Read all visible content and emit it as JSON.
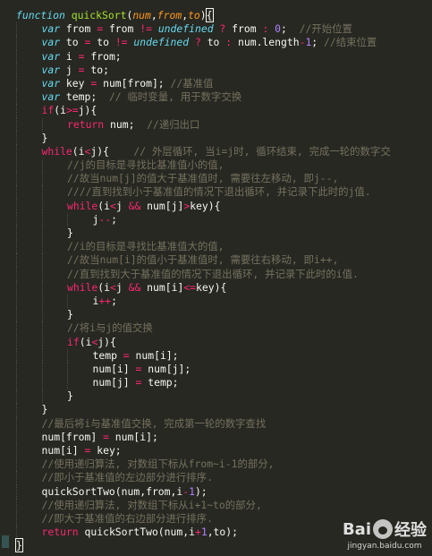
{
  "editor": {
    "colors": {
      "background": "#272822",
      "keyword": "#66d9ef",
      "function": "#a6e22e",
      "argument": "#fd971f",
      "operator": "#f92672",
      "number": "#ae81ff",
      "comment": "#75715e",
      "text": "#f8f8f2"
    },
    "lines": [
      {
        "indent": 0,
        "tokens": [
          [
            "kw",
            "function"
          ],
          [
            "plain",
            " "
          ],
          [
            "fn",
            "quickSort"
          ],
          [
            "plain",
            "("
          ],
          [
            "arg",
            "num"
          ],
          [
            "plain",
            ","
          ],
          [
            "arg",
            "from"
          ],
          [
            "plain",
            ","
          ],
          [
            "arg",
            "to"
          ],
          [
            "plain",
            ")"
          ],
          [
            "brace",
            "{"
          ]
        ]
      },
      {
        "indent": 1,
        "tokens": [
          [
            "kw",
            "var"
          ],
          [
            "plain",
            " from "
          ],
          [
            "pink",
            "="
          ],
          [
            "plain",
            " from "
          ],
          [
            "pink",
            "!="
          ],
          [
            "plain",
            " "
          ],
          [
            "kw",
            "undefined"
          ],
          [
            "plain",
            " "
          ],
          [
            "pink",
            "?"
          ],
          [
            "plain",
            " from "
          ],
          [
            "pink",
            ":"
          ],
          [
            "plain",
            " "
          ],
          [
            "num",
            "0"
          ],
          [
            "plain",
            ";  "
          ],
          [
            "cm",
            "//开始位置"
          ]
        ]
      },
      {
        "indent": 1,
        "tokens": [
          [
            "kw",
            "var"
          ],
          [
            "plain",
            " to "
          ],
          [
            "pink",
            "="
          ],
          [
            "plain",
            " to "
          ],
          [
            "pink",
            "!="
          ],
          [
            "plain",
            " "
          ],
          [
            "kw",
            "undefined"
          ],
          [
            "plain",
            " "
          ],
          [
            "pink",
            "?"
          ],
          [
            "plain",
            " to "
          ],
          [
            "pink",
            ":"
          ],
          [
            "plain",
            " num.length"
          ],
          [
            "pink",
            "-"
          ],
          [
            "num",
            "1"
          ],
          [
            "plain",
            "; "
          ],
          [
            "cm",
            "//结束位置"
          ]
        ]
      },
      {
        "indent": 1,
        "tokens": [
          [
            "kw",
            "var"
          ],
          [
            "plain",
            " i "
          ],
          [
            "pink",
            "="
          ],
          [
            "plain",
            " from;"
          ]
        ]
      },
      {
        "indent": 1,
        "tokens": [
          [
            "kw",
            "var"
          ],
          [
            "plain",
            " j "
          ],
          [
            "pink",
            "="
          ],
          [
            "plain",
            " to;"
          ]
        ]
      },
      {
        "indent": 1,
        "tokens": [
          [
            "kw",
            "var"
          ],
          [
            "plain",
            " key "
          ],
          [
            "pink",
            "="
          ],
          [
            "plain",
            " num[from]; "
          ],
          [
            "cm",
            "//基准值"
          ]
        ]
      },
      {
        "indent": 1,
        "tokens": [
          [
            "kw",
            "var"
          ],
          [
            "plain",
            " temp;  "
          ],
          [
            "cm",
            "// 临时变量, 用于数字交换"
          ]
        ]
      },
      {
        "indent": 1,
        "tokens": [
          [
            "pink",
            "if"
          ],
          [
            "plain",
            "(i"
          ],
          [
            "pink",
            ">="
          ],
          [
            "plain",
            "j){"
          ]
        ]
      },
      {
        "indent": 2,
        "tokens": [
          [
            "pink",
            "return"
          ],
          [
            "plain",
            " num;  "
          ],
          [
            "cm",
            "//递归出口"
          ]
        ]
      },
      {
        "indent": 1,
        "tokens": [
          [
            "plain",
            "}"
          ]
        ]
      },
      {
        "indent": 1,
        "tokens": [
          [
            "pink",
            "while"
          ],
          [
            "plain",
            "(i"
          ],
          [
            "pink",
            "<"
          ],
          [
            "plain",
            "j){    "
          ],
          [
            "cm",
            "// 外层循环, 当i=j时, 循环结束, 完成一轮的数字交"
          ]
        ]
      },
      {
        "indent": 2,
        "tokens": [
          [
            "cm",
            "//j的目标是寻找比基准值小的值,"
          ]
        ]
      },
      {
        "indent": 2,
        "tokens": [
          [
            "cm",
            "//故当num[j]的值大于基准值时, 需要往左移动, 即j--,"
          ]
        ]
      },
      {
        "indent": 2,
        "tokens": [
          [
            "cm",
            "////直到找到小于基准值的情况下退出循环, 并记录下此时的j值."
          ]
        ]
      },
      {
        "indent": 2,
        "tokens": [
          [
            "pink",
            "while"
          ],
          [
            "plain",
            "(i"
          ],
          [
            "pink",
            "<"
          ],
          [
            "plain",
            "j "
          ],
          [
            "pink",
            "&&"
          ],
          [
            "plain",
            " num[j]"
          ],
          [
            "pink",
            ">"
          ],
          [
            "plain",
            "key){"
          ]
        ]
      },
      {
        "indent": 3,
        "tokens": [
          [
            "plain",
            "j"
          ],
          [
            "pink",
            "--"
          ],
          [
            "plain",
            ";"
          ]
        ]
      },
      {
        "indent": 2,
        "tokens": [
          [
            "plain",
            "}"
          ]
        ]
      },
      {
        "indent": 2,
        "tokens": [
          [
            "cm",
            "//i的目标是寻找比基准值大的值,"
          ]
        ]
      },
      {
        "indent": 2,
        "tokens": [
          [
            "cm",
            "//故当num[i]的值小于基准值时, 需要往右移动, 即i++,"
          ]
        ]
      },
      {
        "indent": 2,
        "tokens": [
          [
            "cm",
            "//直到找到大于基准值的情况下退出循环, 并记录下此时的i值."
          ]
        ]
      },
      {
        "indent": 2,
        "tokens": [
          [
            "pink",
            "while"
          ],
          [
            "plain",
            "(i"
          ],
          [
            "pink",
            "<"
          ],
          [
            "plain",
            "j "
          ],
          [
            "pink",
            "&&"
          ],
          [
            "plain",
            " num[i]"
          ],
          [
            "pink",
            "<="
          ],
          [
            "plain",
            "key){"
          ]
        ]
      },
      {
        "indent": 3,
        "tokens": [
          [
            "plain",
            "i"
          ],
          [
            "pink",
            "++"
          ],
          [
            "plain",
            ";"
          ]
        ]
      },
      {
        "indent": 2,
        "tokens": [
          [
            "plain",
            "}"
          ]
        ]
      },
      {
        "indent": 2,
        "tokens": [
          [
            "cm",
            "//将i与j的值交换"
          ]
        ]
      },
      {
        "indent": 2,
        "tokens": [
          [
            "pink",
            "if"
          ],
          [
            "plain",
            "(i"
          ],
          [
            "pink",
            "<"
          ],
          [
            "plain",
            "j){"
          ]
        ]
      },
      {
        "indent": 3,
        "tokens": [
          [
            "plain",
            "temp "
          ],
          [
            "pink",
            "="
          ],
          [
            "plain",
            " num[i];"
          ]
        ]
      },
      {
        "indent": 3,
        "tokens": [
          [
            "plain",
            "num[i] "
          ],
          [
            "pink",
            "="
          ],
          [
            "plain",
            " num[j];"
          ]
        ]
      },
      {
        "indent": 3,
        "tokens": [
          [
            "plain",
            "num[j] "
          ],
          [
            "pink",
            "="
          ],
          [
            "plain",
            " temp;"
          ]
        ]
      },
      {
        "indent": 2,
        "tokens": [
          [
            "plain",
            "}"
          ]
        ]
      },
      {
        "indent": 1,
        "tokens": [
          [
            "plain",
            "}"
          ]
        ]
      },
      {
        "indent": 1,
        "tokens": [
          [
            "cm",
            "//最后将i与基准值交换, 完成第一轮的数字查找"
          ]
        ]
      },
      {
        "indent": 1,
        "tokens": [
          [
            "plain",
            "num[from] "
          ],
          [
            "pink",
            "="
          ],
          [
            "plain",
            " num[i];"
          ]
        ]
      },
      {
        "indent": 1,
        "tokens": [
          [
            "plain",
            "num[i] "
          ],
          [
            "pink",
            "="
          ],
          [
            "plain",
            " key;"
          ]
        ]
      },
      {
        "indent": 1,
        "tokens": [
          [
            "cm",
            "//使用递归算法, 对数组下标从from~i-1的部分,"
          ]
        ]
      },
      {
        "indent": 1,
        "tokens": [
          [
            "cm",
            "//即小于基准值的左边部分进行排序."
          ]
        ]
      },
      {
        "indent": 1,
        "tokens": [
          [
            "plain",
            "quickSortTwo(num,from,i"
          ],
          [
            "pink",
            "-"
          ],
          [
            "num",
            "1"
          ],
          [
            "plain",
            ");"
          ]
        ]
      },
      {
        "indent": 1,
        "tokens": [
          [
            "cm",
            "//使用递归算法, 对数组下标从i+1~to的部分,"
          ]
        ]
      },
      {
        "indent": 1,
        "tokens": [
          [
            "cm",
            "//即大于基准值的右边部分进行排序."
          ]
        ]
      },
      {
        "indent": 1,
        "tokens": [
          [
            "pink",
            "return"
          ],
          [
            "plain",
            " quickSortTwo(num,i"
          ],
          [
            "pink",
            "+"
          ],
          [
            "num",
            "1"
          ],
          [
            "plain",
            ",to);"
          ]
        ]
      },
      {
        "indent": 0,
        "tokens": [
          [
            "brace",
            "}"
          ]
        ]
      }
    ]
  },
  "watermark": {
    "brand": "Bai",
    "brand_cn": "经验",
    "url": "jingyan.baidu.com"
  }
}
